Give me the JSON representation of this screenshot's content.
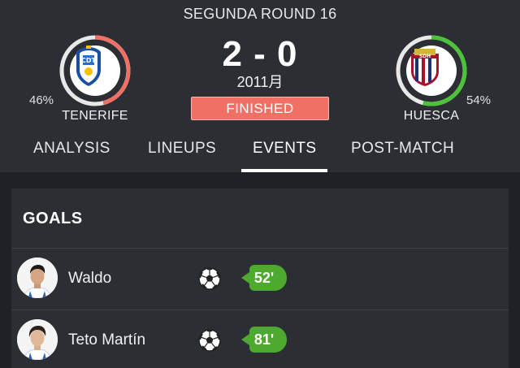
{
  "match": {
    "round": "SEGUNDA ROUND 16",
    "score": "2 - 0",
    "date": "2011月",
    "status": "FINISHED",
    "status_color": "#f07066"
  },
  "home": {
    "name": "TENERIFE",
    "possession": "46%",
    "possession_value": 46,
    "ring_color": "#f07066",
    "crest_initials": "C D T"
  },
  "away": {
    "name": "HUESCA",
    "possession": "54%",
    "possession_value": 54,
    "ring_color": "#4cc23a",
    "crest_initials": "S.D.H"
  },
  "tabs": [
    {
      "label": "ANALYSIS",
      "active": false
    },
    {
      "label": "LINEUPS",
      "active": false
    },
    {
      "label": "EVENTS",
      "active": true
    },
    {
      "label": "POST-MATCH",
      "active": false
    }
  ],
  "goals": {
    "title": "GOALS",
    "items": [
      {
        "player": "Waldo",
        "minute": "52'",
        "icon": "soccer-ball-icon"
      },
      {
        "player": "Teto Martín",
        "minute": "81'",
        "icon": "soccer-ball-icon"
      }
    ],
    "minute_color": "#4ea92f"
  }
}
